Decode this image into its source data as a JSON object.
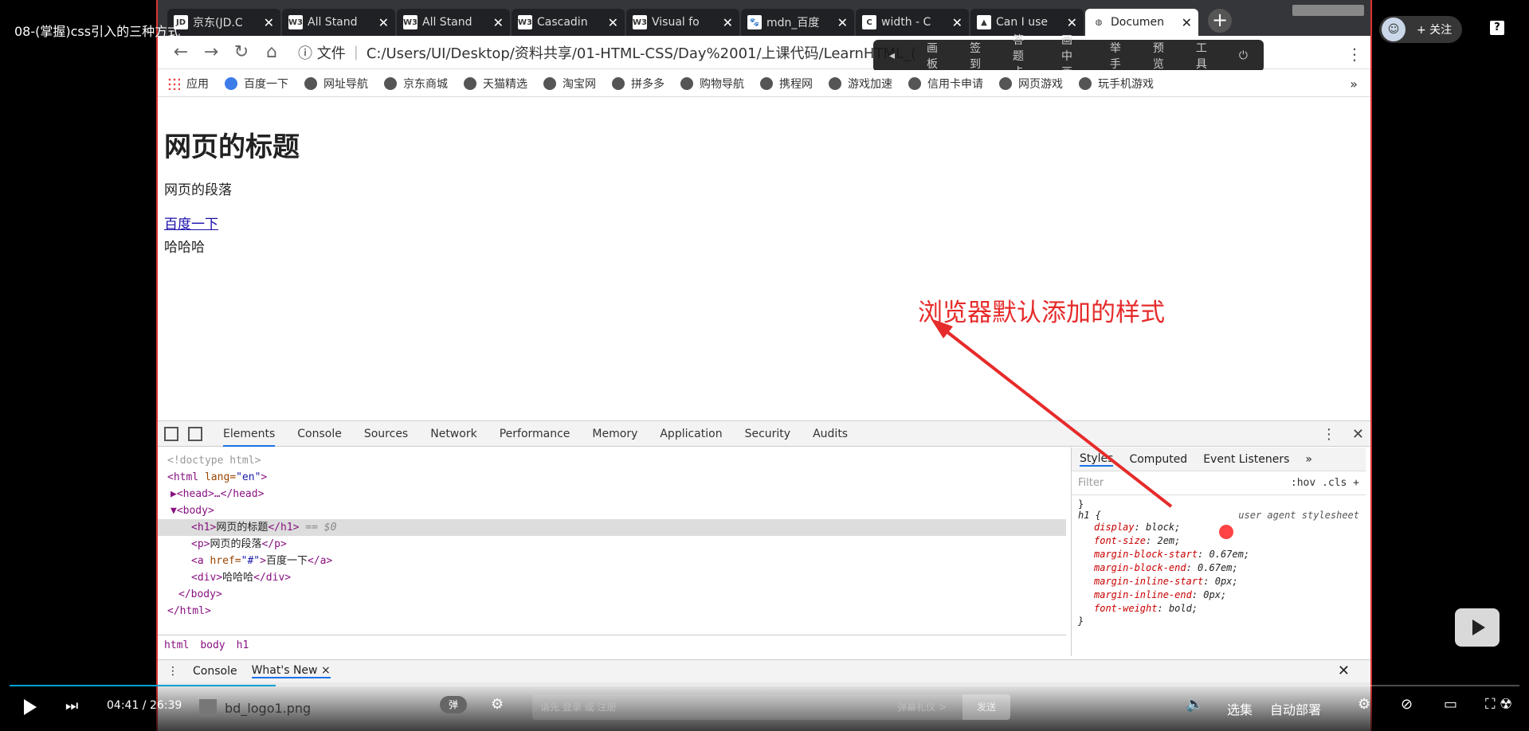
{
  "video": {
    "title": "08-(掌握)css引入的三种方式",
    "follow": "+ 关注",
    "current_time": "04:41",
    "duration": "26:39",
    "progress_fraction": 0.176,
    "danmu_placeholder": "请先 登录 或 注册",
    "danmu_etiquette": "弹幕礼仪 >",
    "send_label": "发送",
    "select_label": "选集",
    "auto_label": "自动",
    "quality_label": "部署"
  },
  "browser": {
    "tabs": [
      {
        "icon": "JD",
        "title": "京东(JD.C"
      },
      {
        "icon": "W3",
        "title": "All Stand"
      },
      {
        "icon": "W3",
        "title": "All Stand"
      },
      {
        "icon": "W3",
        "title": "Cascadin"
      },
      {
        "icon": "W3",
        "title": "Visual fo"
      },
      {
        "icon": "paw",
        "title": "mdn_百度"
      },
      {
        "icon": "C",
        "title": "width - C"
      },
      {
        "icon": "caniuse",
        "title": "Can I use"
      },
      {
        "icon": "globe",
        "title": "Documen"
      }
    ],
    "address": {
      "file_label": "文件",
      "url": "C:/Users/UI/Desktop/资料共享/01-HTML-CSS/Day%2001/上课代码/LearnHTML_("
    },
    "floating_toolbar": [
      "画板",
      "签到",
      "答题卡",
      "画中画",
      "举手",
      "预览",
      "工具"
    ],
    "bookmarks": [
      "应用",
      "百度一下",
      "网址导航",
      "京东商城",
      "天猫精选",
      "淘宝网",
      "拼多多",
      "购物导航",
      "携程网",
      "游戏加速",
      "信用卡申请",
      "网页游戏",
      "玩手机游戏"
    ],
    "bookmarks_more": "»"
  },
  "page": {
    "h1": "网页的标题",
    "p": "网页的段落",
    "a": "百度一下",
    "div": "哈哈哈"
  },
  "annotation": {
    "text": "浏览器默认添加的样式"
  },
  "devtools": {
    "tabs": [
      "Elements",
      "Console",
      "Sources",
      "Network",
      "Performance",
      "Memory",
      "Application",
      "Security",
      "Audits"
    ],
    "active_tab": "Elements",
    "dom": {
      "doctype": "<!doctype html>",
      "html_open": "<html",
      "html_attr": "lang=",
      "html_val": "\"en\"",
      "head": "▶<head>…</head>",
      "body_open": "▼<body>",
      "h1_open": "<h1>",
      "h1_text": "网页的标题",
      "h1_close": "</h1>",
      "h1_eq": "== $0",
      "p_open": "<p>",
      "p_text": "网页的段落",
      "p_close": "</p>",
      "a_open": "<a",
      "a_attr": "href=",
      "a_val": "\"#\"",
      "a_text": "百度一下",
      "a_close": "</a>",
      "div_open": "<div>",
      "div_text": "哈哈哈",
      "div_close": "</div>",
      "body_close": "</body>",
      "html_close": "</html>"
    },
    "breadcrumb": [
      "html",
      "body",
      "h1"
    ],
    "styles_tabs": [
      "Styles",
      "Computed",
      "Event Listeners",
      "»"
    ],
    "filter_placeholder": "Filter",
    "filter_right": ":hov  .cls  +",
    "rule": {
      "selector": "h1 {",
      "source": "user agent stylesheet",
      "props": [
        {
          "name": "display",
          "value": "block;"
        },
        {
          "name": "font-size",
          "value": "2em;"
        },
        {
          "name": "margin-block-start",
          "value": "0.67em;"
        },
        {
          "name": "margin-block-end",
          "value": "0.67em;"
        },
        {
          "name": "margin-inline-start",
          "value": "0px;"
        },
        {
          "name": "margin-inline-end",
          "value": "0px;"
        },
        {
          "name": "font-weight",
          "value": "bold;"
        }
      ],
      "close": "}"
    },
    "drawer_tabs": [
      "Console",
      "What's New ×"
    ]
  },
  "download": {
    "file": "bd_logo1.png"
  },
  "colors": {
    "accent": "#00a1d6",
    "annotation": "#e62b2b"
  }
}
